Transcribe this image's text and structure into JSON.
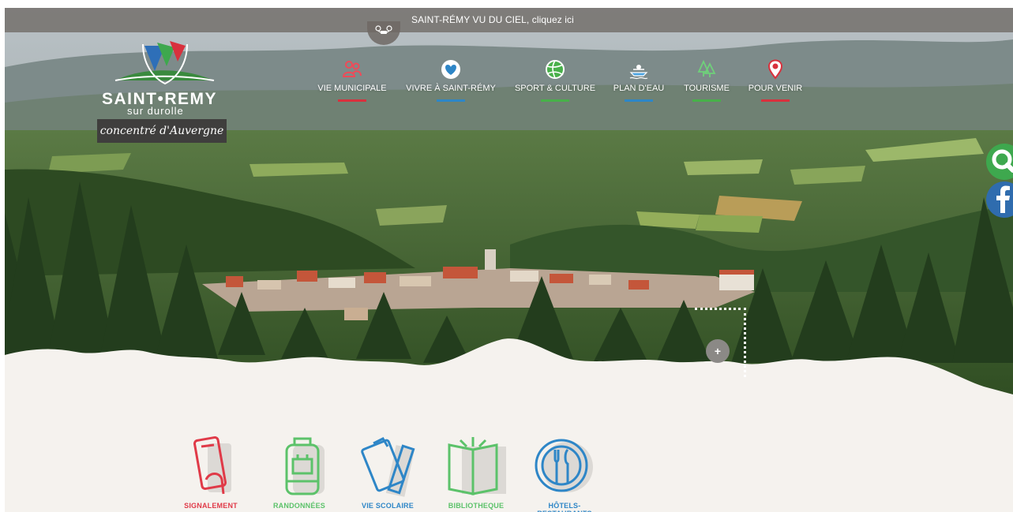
{
  "banner": {
    "text": "SAINT-RÉMY VU DU CIEL, cliquez ici",
    "icon": "drone-icon"
  },
  "logo": {
    "name": "SAINT•REMY",
    "subtitle": "sur durolle",
    "tagline": "concentré d'Auvergne"
  },
  "nav": [
    {
      "label": "VIE MUNICIPALE",
      "icon": "people-icon",
      "color": "#d8313d"
    },
    {
      "label": "VIVRE À SAINT-RÉMY",
      "icon": "heart-icon",
      "color": "#2e86c7"
    },
    {
      "label": "SPORT & CULTURE",
      "icon": "volleyball-icon",
      "color": "#48b04a"
    },
    {
      "label": "PLAN D'EAU",
      "icon": "boat-icon",
      "color": "#2e86c7"
    },
    {
      "label": "TOURISME",
      "icon": "trees-icon",
      "color": "#48b04a"
    },
    {
      "label": "POUR VENIR",
      "icon": "location-pin-icon",
      "color": "#d8313d"
    }
  ],
  "side": {
    "search_icon": "search-icon",
    "facebook_icon": "facebook-icon",
    "search_color": "#3ea84e",
    "facebook_color": "#2f6cae"
  },
  "more_button": "+",
  "quick_links": [
    {
      "label": "SIGNALEMENT",
      "icon": "phone-hand-icon",
      "color": "#e03a48"
    },
    {
      "label": "RANDONNÉES",
      "icon": "backpack-icon",
      "color": "#5cc26a"
    },
    {
      "label": "VIE SCOLAIRE",
      "icon": "clipboard-ruler-icon",
      "color": "#2e86c7"
    },
    {
      "label": "BIBLIOTHEQUE",
      "icon": "book-icon",
      "color": "#5cc26a"
    },
    {
      "label": "HÔTELS-RESTAURANTS",
      "icon": "fork-knife-icon",
      "color": "#2e86c7"
    }
  ]
}
